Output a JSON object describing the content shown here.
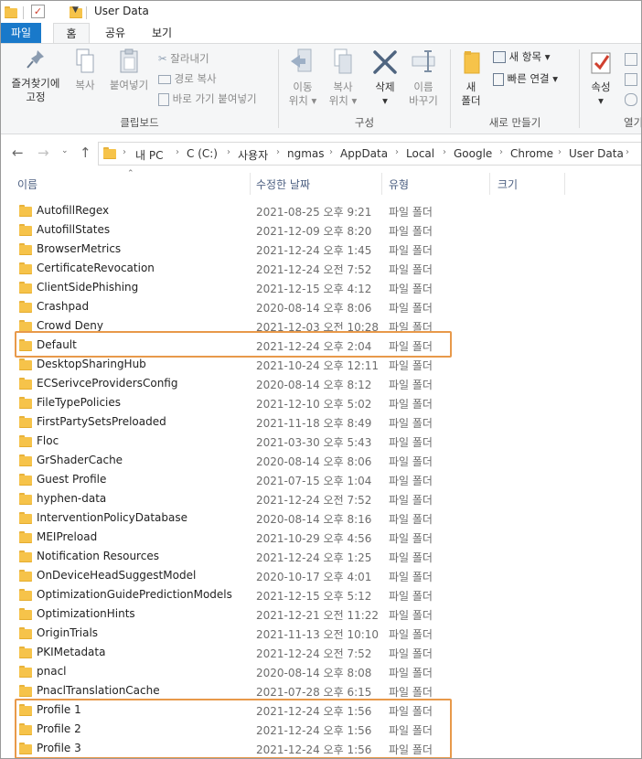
{
  "window": {
    "title": "User Data"
  },
  "tabs": [
    {
      "label": "파일"
    },
    {
      "label": "홈"
    },
    {
      "label": "공유"
    },
    {
      "label": "보기"
    }
  ],
  "ribbon": {
    "pin": "즐겨찾기에\n고정",
    "copy": "복사",
    "paste": "붙여넣기",
    "cut": "잘라내기",
    "copy_path": "경로 복사",
    "paste_shortcut": "바로 가기 붙여넣기",
    "clipboard_group": "클립보드",
    "move_to": "이동\n위치 ▾",
    "copy_to": "복사\n위치 ▾",
    "delete": "삭제\n▾",
    "rename": "이름\n바꾸기",
    "organize_group": "구성",
    "new_folder": "새\n폴더",
    "new_item": "새 항목 ▾",
    "easy_access": "빠른 연결 ▾",
    "new_group": "새로 만들기",
    "properties": "속성\n▾",
    "open_group": "열기"
  },
  "breadcrumb": [
    "내 PC",
    "C (C:)",
    "사용자",
    "ngmas",
    "AppData",
    "Local",
    "Google",
    "Chrome",
    "User Data"
  ],
  "columns": {
    "name": "이름",
    "date": "수정한 날짜",
    "type": "유형",
    "size": "크기"
  },
  "files": [
    {
      "name": "AutofillRegex",
      "date": "2021-08-25 오후 9:21",
      "type": "파일 폴더"
    },
    {
      "name": "AutofillStates",
      "date": "2021-12-09 오후 8:20",
      "type": "파일 폴더"
    },
    {
      "name": "BrowserMetrics",
      "date": "2021-12-24 오후 1:45",
      "type": "파일 폴더"
    },
    {
      "name": "CertificateRevocation",
      "date": "2021-12-24 오전 7:52",
      "type": "파일 폴더"
    },
    {
      "name": "ClientSidePhishing",
      "date": "2021-12-15 오후 4:12",
      "type": "파일 폴더"
    },
    {
      "name": "Crashpad",
      "date": "2020-08-14 오후 8:06",
      "type": "파일 폴더"
    },
    {
      "name": "Crowd Deny",
      "date": "2021-12-03 오전 10:28",
      "type": "파일 폴더"
    },
    {
      "name": "Default",
      "date": "2021-12-24 오후 2:04",
      "type": "파일 폴더"
    },
    {
      "name": "DesktopSharingHub",
      "date": "2021-10-24 오후 12:11",
      "type": "파일 폴더"
    },
    {
      "name": "ECSerivceProvidersConfig",
      "date": "2020-08-14 오후 8:12",
      "type": "파일 폴더"
    },
    {
      "name": "FileTypePolicies",
      "date": "2021-12-10 오후 5:02",
      "type": "파일 폴더"
    },
    {
      "name": "FirstPartySetsPreloaded",
      "date": "2021-11-18 오후 8:49",
      "type": "파일 폴더"
    },
    {
      "name": "Floc",
      "date": "2021-03-30 오후 5:43",
      "type": "파일 폴더"
    },
    {
      "name": "GrShaderCache",
      "date": "2020-08-14 오후 8:06",
      "type": "파일 폴더"
    },
    {
      "name": "Guest Profile",
      "date": "2021-07-15 오후 1:04",
      "type": "파일 폴더"
    },
    {
      "name": "hyphen-data",
      "date": "2021-12-24 오전 7:52",
      "type": "파일 폴더"
    },
    {
      "name": "InterventionPolicyDatabase",
      "date": "2020-08-14 오후 8:16",
      "type": "파일 폴더"
    },
    {
      "name": "MEIPreload",
      "date": "2021-10-29 오후 4:56",
      "type": "파일 폴더"
    },
    {
      "name": "Notification Resources",
      "date": "2021-12-24 오후 1:25",
      "type": "파일 폴더"
    },
    {
      "name": "OnDeviceHeadSuggestModel",
      "date": "2020-10-17 오후 4:01",
      "type": "파일 폴더"
    },
    {
      "name": "OptimizationGuidePredictionModels",
      "date": "2021-12-15 오후 5:12",
      "type": "파일 폴더"
    },
    {
      "name": "OptimizationHints",
      "date": "2021-12-21 오전 11:22",
      "type": "파일 폴더"
    },
    {
      "name": "OriginTrials",
      "date": "2021-11-13 오전 10:10",
      "type": "파일 폴더"
    },
    {
      "name": "PKIMetadata",
      "date": "2021-12-24 오전 7:52",
      "type": "파일 폴더"
    },
    {
      "name": "pnacl",
      "date": "2020-08-14 오후 8:08",
      "type": "파일 폴더"
    },
    {
      "name": "PnaclTranslationCache",
      "date": "2021-07-28 오후 6:15",
      "type": "파일 폴더"
    },
    {
      "name": "Profile 1",
      "date": "2021-12-24 오후 1:56",
      "type": "파일 폴더"
    },
    {
      "name": "Profile 2",
      "date": "2021-12-24 오후 1:56",
      "type": "파일 폴더"
    },
    {
      "name": "Profile 3",
      "date": "2021-12-24 오후 1:56",
      "type": "파일 폴더"
    }
  ],
  "colors": {
    "accent": "#1979ca",
    "highlight": "#e8994a",
    "folder": "#f6c34a"
  }
}
